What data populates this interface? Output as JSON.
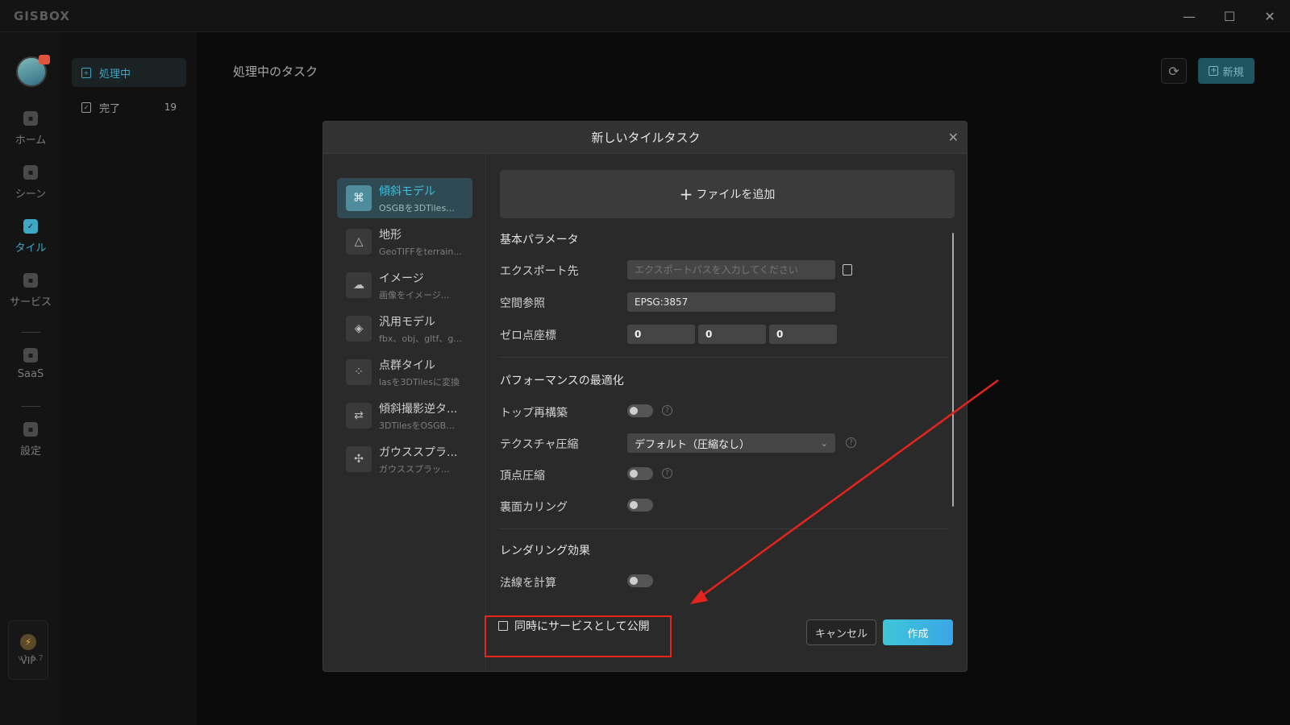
{
  "app": {
    "title": "GISBOX"
  },
  "window_controls": {
    "minimize": "—",
    "maximize": "☐",
    "close": "✕"
  },
  "rail": {
    "items": [
      {
        "label": "ホーム",
        "icon": "home-icon"
      },
      {
        "label": "シーン",
        "icon": "scene-icon"
      },
      {
        "label": "タイル",
        "icon": "tile-icon"
      },
      {
        "label": "サービス",
        "icon": "service-icon"
      },
      {
        "label": "SaaS",
        "icon": "lock-icon"
      },
      {
        "label": "設定",
        "icon": "gear-icon"
      }
    ],
    "vip_label": "VIP",
    "version": "v1.1.7"
  },
  "sidebar": {
    "items": [
      {
        "label": "処理中",
        "icon": "file-plus-icon",
        "count": ""
      },
      {
        "label": "完了",
        "icon": "file-check-icon",
        "count": "19"
      }
    ]
  },
  "main": {
    "title": "処理中のタスク",
    "new_button": "新規"
  },
  "modal": {
    "title": "新しいタイルタスク",
    "types": [
      {
        "name": "傾斜モデル",
        "desc": "OSGBを3DTilesに...",
        "icon": "oblique-model-icon"
      },
      {
        "name": "地形",
        "desc": "GeoTIFFをterrain...",
        "icon": "terrain-icon"
      },
      {
        "name": "イメージ",
        "desc": "画像をイメージ...",
        "icon": "image-icon"
      },
      {
        "name": "汎用モデル",
        "desc": "fbx、obj、gltf、g...",
        "icon": "cube-icon"
      },
      {
        "name": "点群タイル",
        "desc": "lasを3DTilesに変換",
        "icon": "point-cloud-icon"
      },
      {
        "name": "傾斜撮影逆タ...",
        "desc": "3DTilesをOSGBに...",
        "icon": "reverse-convert-icon"
      },
      {
        "name": "ガウススプラ...",
        "desc": "ガウススプラッ...",
        "icon": "gaussian-splat-icon"
      }
    ],
    "add_file": "ファイルを追加",
    "basic": {
      "title": "基本パラメータ",
      "export_label": "エクスポート先",
      "export_placeholder": "エクスポートパスを入力してください",
      "crs_label": "空間参照",
      "crs_value": "EPSG:3857",
      "origin_label": "ゼロ点座標",
      "origin": [
        "0",
        "0",
        "0"
      ]
    },
    "performance": {
      "title": "パフォーマンスの最適化",
      "rebuild_label": "トップ再構築",
      "rebuild_on": false,
      "texture_label": "テクスチャ圧縮",
      "texture_value": "デフォルト（圧縮なし）",
      "vertex_label": "頂点圧縮",
      "vertex_on": false,
      "culling_label": "裏面カリング",
      "culling_on": false
    },
    "rendering": {
      "title": "レンダリング効果",
      "normals_label": "法線を計算",
      "normals_on": false
    },
    "publish_label": "同時にサービスとして公開",
    "publish_checked": false,
    "cancel": "キャンセル",
    "create": "作成"
  },
  "colors": {
    "accent": "#3fa7c4",
    "annotation": "#e5241d"
  }
}
